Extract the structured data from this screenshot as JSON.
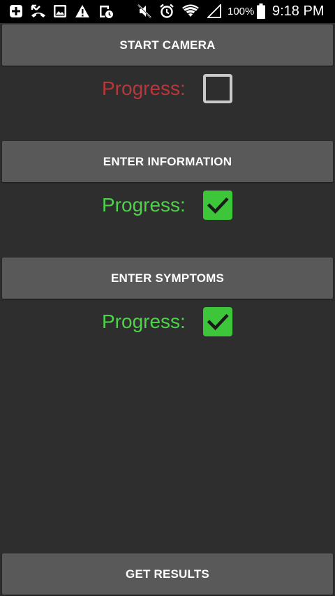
{
  "status_bar": {
    "battery_percent": "100%",
    "time": "9:18 PM",
    "icons": [
      "plus-box-icon",
      "missed-call-icon",
      "image-icon",
      "warning-icon",
      "schedule-icon",
      "muted-icon",
      "alarm-icon",
      "wifi-icon",
      "signal-icon",
      "battery-icon"
    ]
  },
  "buttons": {
    "start_camera": "START CAMERA",
    "enter_information": "ENTER INFORMATION",
    "enter_symptoms": "ENTER SYMPTOMS",
    "get_results": "GET RESULTS"
  },
  "progress": [
    {
      "label": "Progress:",
      "checked": false,
      "color": "#b8373a"
    },
    {
      "label": "Progress:",
      "checked": true,
      "color": "#4fd24a"
    },
    {
      "label": "Progress:",
      "checked": true,
      "color": "#4fd24a"
    }
  ],
  "colors": {
    "background": "#2e2e2e",
    "button": "#595959",
    "checkbox_checked": "#3ec63a",
    "checkbox_unchecked_border": "#c9c9c9"
  }
}
